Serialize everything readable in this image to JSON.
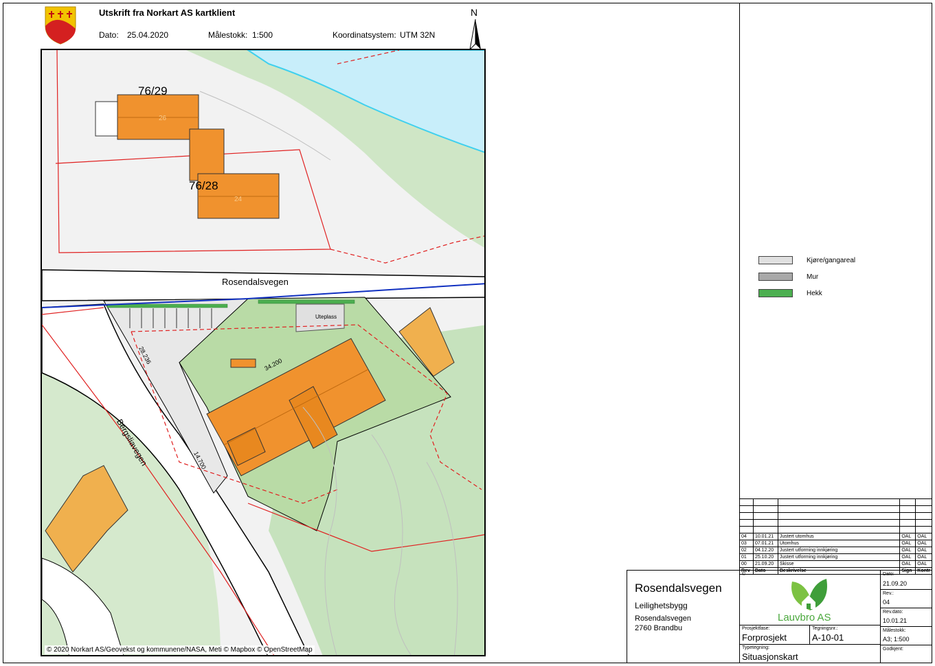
{
  "header": {
    "title": "Utskrift fra Norkart AS kartklient",
    "date_label": "Dato:",
    "date_value": "25.04.2020",
    "scale_label": "Målestokk:",
    "scale_value": "1:500",
    "coord_label": "Koordinatsystem:",
    "coord_value": "UTM 32N",
    "north_label": "N",
    "crest_icon": "municipality-crest-icon"
  },
  "map": {
    "road_north": "Rosendalsvegen",
    "road_west": "Bergsliavegen",
    "parcel_1": "76/29",
    "parcel_2": "76/28",
    "house_1_number": "26",
    "house_2_number": "24",
    "uteplass": "Uteplass",
    "dim_1": "34.200",
    "dim_2": "28.236",
    "dim_3": "14.700",
    "attribution": "© 2020 Norkart AS/Geovekst og kommunene/NASA, Meti © Mapbox © OpenStreetMap"
  },
  "legend": {
    "items": [
      {
        "label": "Kjøre/gangareal",
        "color": "#e0e0e0"
      },
      {
        "label": "Mur",
        "color": "#a8a8a8"
      },
      {
        "label": "Hekk",
        "color": "#4caf50"
      }
    ]
  },
  "revisions": {
    "rows": [
      {
        "rev": "04",
        "date": "10.01.21",
        "desc": "Justert utomhus",
        "sign": "OAL",
        "kontr": "OAL"
      },
      {
        "rev": "03",
        "date": "07.01.21",
        "desc": "Utomhus",
        "sign": "OAL",
        "kontr": "OAL"
      },
      {
        "rev": "02",
        "date": "04.12.20",
        "desc": "Justert utforming innkjøring",
        "sign": "OAL",
        "kontr": "OAL"
      },
      {
        "rev": "01",
        "date": "25.10.20",
        "desc": "Justert utforming innkjøring",
        "sign": "OAL",
        "kontr": "OAL"
      },
      {
        "rev": "00",
        "date": "21.09.20",
        "desc": "Skisse",
        "sign": "OAL",
        "kontr": "OAL"
      }
    ],
    "head": {
      "rev": "Rev",
      "date": "Dato",
      "desc": "Beskrivelse",
      "sign": "Sign",
      "kontr": "Kontr"
    }
  },
  "title_block": {
    "project_name": "Rosendalsvegen",
    "project_type": "Leilighetsbygg",
    "address_line1": "Rosendalsvegen",
    "address_line2": "2760 Brandbu",
    "copyright_symbol": "©",
    "company": "Lauvbro AS",
    "phase_label": "Prosjektfase:",
    "phase_value": "Forprosjekt",
    "drawing_no_label": "Tegningsnr.:",
    "drawing_no_value": "A-10-01",
    "drawing_type_label": "Typetegning:",
    "drawing_type_value": "Situasjonskart",
    "date_label": "Dato:",
    "date_value": "21.09.20",
    "rev_label": "Rev.:",
    "rev_value": "04",
    "rev_date_label": "Rev.dato:",
    "rev_date_value": "10.01.21",
    "scale_label": "Målestokk:",
    "scale_value": "A3; 1:500",
    "approved_label": "Godkjent:"
  }
}
